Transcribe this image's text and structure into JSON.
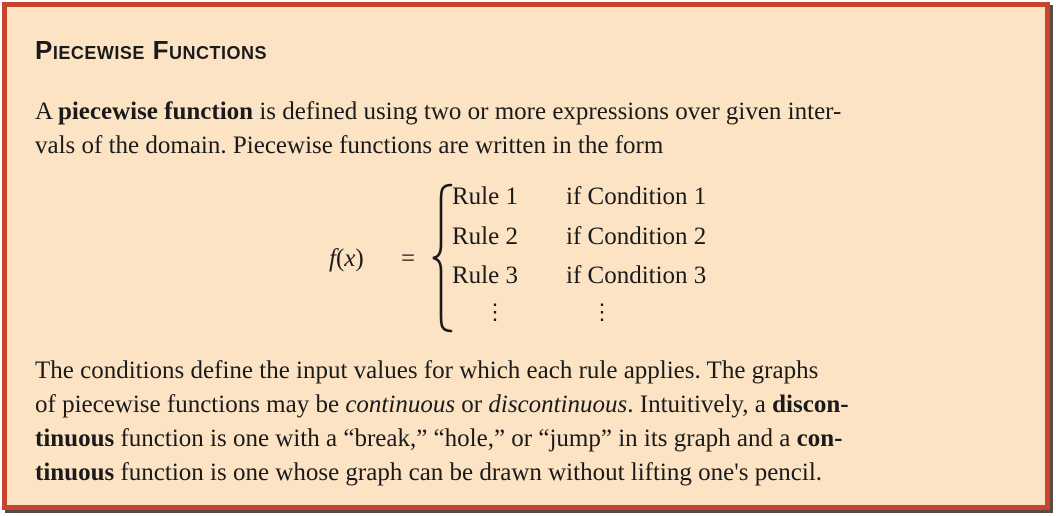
{
  "heading": "Piecewise Functions",
  "intro": {
    "part1": "A ",
    "term": "piecewise function",
    "part2": " is defined using two or more expressions over given inter-",
    "line2": "vals of the domain. Piecewise functions are written in the form"
  },
  "formula": {
    "lhs_name": "f",
    "lhs_open": "(",
    "lhs_var": "x",
    "lhs_close": ")",
    "equals": "=",
    "rows": [
      {
        "rule": "Rule 1",
        "condition": "if Condition 1"
      },
      {
        "rule": "Rule 2",
        "condition": "if Condition 2"
      },
      {
        "rule": "Rule 3",
        "condition": "if Condition 3"
      }
    ],
    "vdots": "⋮"
  },
  "body": {
    "line1": "The conditions define the input values for which each rule applies. The graphs",
    "line2a": "of piecewise functions may be ",
    "continuous": "continuous",
    "or": " or ",
    "discontinuous": "discontinuous",
    "line2b": ". Intuitively, a ",
    "discon": "discon-",
    "line3a": "tinuous",
    "line3b": " function is one with a “break,” “hole,” or “jump” in its graph and a ",
    "con": "con-",
    "line4a": "tinuous",
    "line4b": " function is one whose graph can be drawn without lifting one's pencil."
  },
  "colors": {
    "border": "#c8442e",
    "background": "#fbe3c4"
  }
}
